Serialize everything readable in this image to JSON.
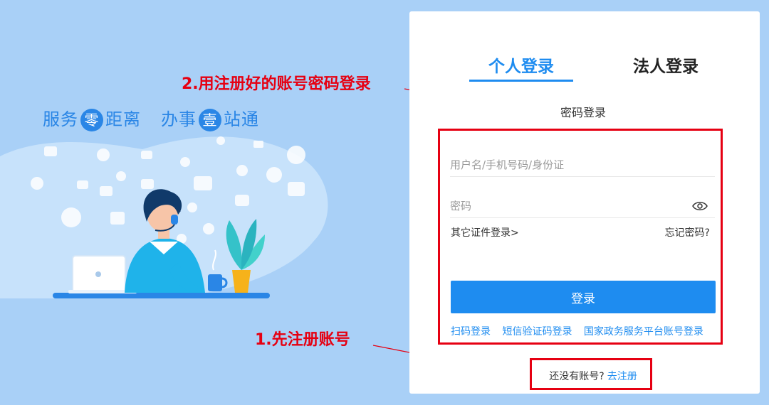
{
  "slogan": {
    "part1_a": "服务",
    "part1_circle": "零",
    "part1_b": "距离",
    "part2_a": "办事",
    "part2_circle": "壹",
    "part2_b": "站通"
  },
  "annotations": {
    "step2": "2.用注册好的账号密码登录",
    "step1": "1.先注册账号"
  },
  "tabs": [
    {
      "label": "个人登录",
      "active": true
    },
    {
      "label": "法人登录",
      "active": false
    }
  ],
  "login_mode": "密码登录",
  "form": {
    "username_placeholder": "用户名/手机号码/身份证",
    "password_placeholder": "密码",
    "other_cert_link": "其它证件登录>",
    "forgot_link": "忘记密码?",
    "submit_label": "登录"
  },
  "alt_login": {
    "scan": "扫码登录",
    "sms": "短信验证码登录",
    "gov": "国家政务服务平台账号登录"
  },
  "register": {
    "prompt": "还没有账号?",
    "link": "去注册"
  },
  "colors": {
    "accent": "#1e8cf0",
    "annotation_red": "#e60012",
    "background": "#a9d0f7"
  }
}
